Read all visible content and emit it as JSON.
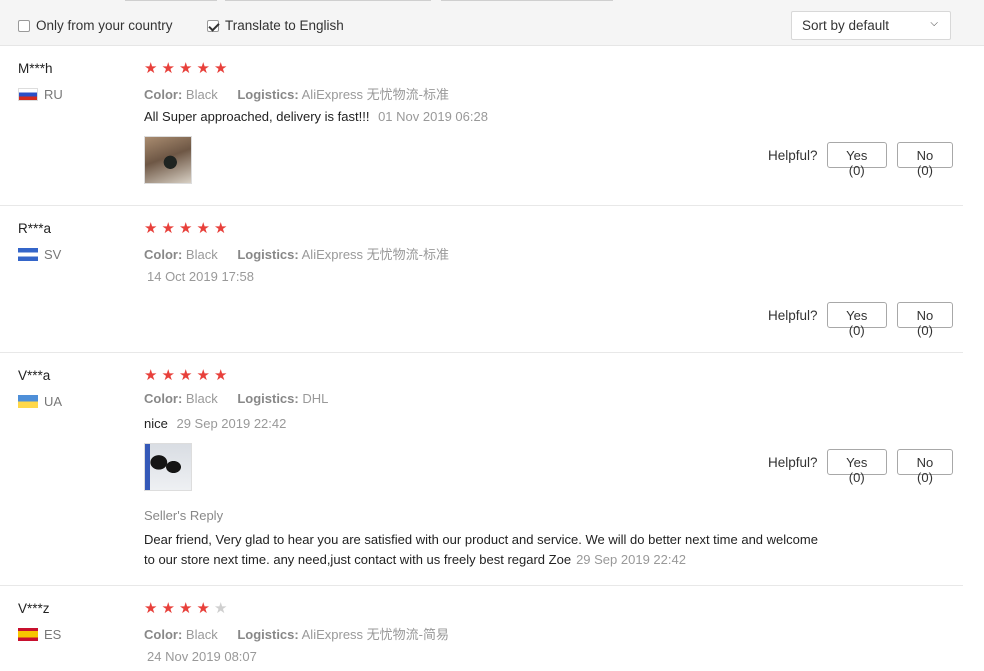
{
  "filters": {
    "only_country": {
      "label": "Only from your country",
      "checked": false
    },
    "translate": {
      "label": "Translate to English",
      "checked": true
    },
    "sort": {
      "label": "Sort by default"
    }
  },
  "labels": {
    "color": "Color:",
    "logistics": "Logistics:",
    "helpful": "Helpful?",
    "seller_reply": "Seller's Reply"
  },
  "reviews": [
    {
      "user": "M***h",
      "country": "RU",
      "stars": 5,
      "color": "Black",
      "logistics": "AliExpress 无忧物流-标准",
      "text": "All Super approached, delivery is fast!!!",
      "date": "01 Nov 2019 06:28",
      "yes": "Yes (0)",
      "no": "No (0)"
    },
    {
      "user": "R***a",
      "country": "SV",
      "stars": 5,
      "color": "Black",
      "logistics": "AliExpress 无忧物流-标准",
      "text": "",
      "date": "14 Oct 2019 17:58",
      "yes": "Yes (0)",
      "no": "No (0)"
    },
    {
      "user": "V***a",
      "country": "UA",
      "stars": 5,
      "color": "Black",
      "logistics": "DHL",
      "text": "nice",
      "date": "29 Sep 2019 22:42",
      "yes": "Yes (0)",
      "no": "No (0)",
      "reply": {
        "text": "Dear friend, Very glad to hear you are satisfied with our product and service. We will do better next time and welcome to our store next time. any need,just contact with us freely best regard Zoe",
        "date": "29 Sep 2019 22:42"
      }
    },
    {
      "user": "V***z",
      "country": "ES",
      "stars": 4,
      "color": "Black",
      "logistics": "AliExpress 无忧物流-简易",
      "text": "",
      "date": "24 Nov 2019 08:07"
    }
  ],
  "colors": {
    "star": "#e8403b",
    "star_off": "#cfcfcf",
    "muted": "#999999"
  }
}
